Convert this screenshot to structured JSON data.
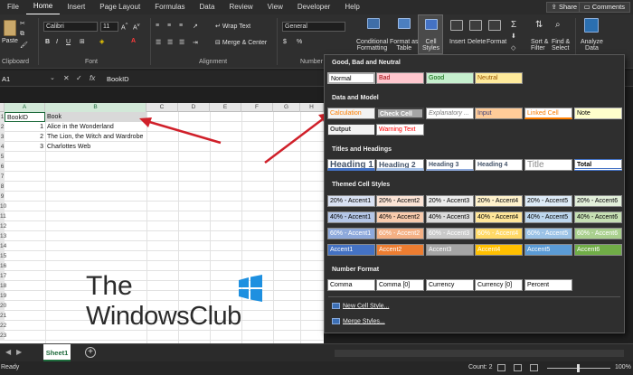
{
  "menu": {
    "tabs": [
      "File",
      "Home",
      "Insert",
      "Page Layout",
      "Formulas",
      "Data",
      "Review",
      "View",
      "Developer",
      "Help"
    ],
    "active": "Home",
    "share": "Share",
    "comments": "Comments"
  },
  "ribbon": {
    "paste": "Paste",
    "font_name": "Calibri",
    "font_size": "11",
    "wrap_text": "Wrap Text",
    "merge_center": "Merge & Center",
    "number_format": "General",
    "conditional_formatting_1": "Conditional",
    "conditional_formatting_2": "Formatting",
    "format_as_table_1": "Format as",
    "format_as_table_2": "Table",
    "cell_styles_1": "Cell",
    "cell_styles_2": "Styles",
    "insert": "Insert",
    "delete": "Delete",
    "format": "Format",
    "sort_filter_1": "Sort &",
    "sort_filter_2": "Filter",
    "find_select_1": "Find &",
    "find_select_2": "Select",
    "analyze_data_1": "Analyze",
    "analyze_data_2": "Data",
    "groups": {
      "clipboard": "Clipboard",
      "font": "Font",
      "alignment": "Alignment",
      "number": "Number"
    },
    "bold": "B",
    "italic": "I",
    "underline": "U",
    "dollar": "$",
    "percent": "%",
    "sigma": "Σ"
  },
  "formula_bar": {
    "name_box": "A1",
    "fx": "fx",
    "content": "BookID"
  },
  "grid": {
    "columns": [
      "A",
      "B",
      "C",
      "D",
      "E",
      "F",
      "G",
      "H"
    ],
    "row_numbers": [
      "1",
      "2",
      "3",
      "4",
      "5",
      "6",
      "7",
      "8",
      "9",
      "10",
      "11",
      "12",
      "13",
      "14",
      "15",
      "16",
      "17",
      "18",
      "19",
      "20",
      "21",
      "22",
      "23"
    ],
    "header_row": [
      "BookID",
      "Book"
    ],
    "rows": [
      {
        "id": "1",
        "book": "Alice in the Wonderland"
      },
      {
        "id": "2",
        "book": "The Lion, the Witch and Wardrobe"
      },
      {
        "id": "3",
        "book": "Charlottes Web"
      }
    ]
  },
  "branding": {
    "line1": "The",
    "line2": "WindowsClub"
  },
  "sheets": {
    "tabs": [
      "Sheet1"
    ],
    "add": "+"
  },
  "status": {
    "ready": "Ready",
    "count": "Count: 2",
    "zoom": "100%"
  },
  "cell_styles": {
    "sections": {
      "good_bad_neutral": "Good, Bad and Neutral",
      "data_model": "Data and Model",
      "titles_headings": "Titles and Headings",
      "themed": "Themed Cell Styles",
      "number_format": "Number Format"
    },
    "good_bad_neutral": [
      "Normal",
      "Bad",
      "Good",
      "Neutral"
    ],
    "data_model": [
      "Calculation",
      "Check Cell",
      "Explanatory ...",
      "Input",
      "Linked Cell",
      "Note",
      "Output",
      "Warning Text"
    ],
    "titles_headings": [
      "Heading 1",
      "Heading 2",
      "Heading 3",
      "Heading 4",
      "Title",
      "Total"
    ],
    "themed_20": [
      "20% - Accent1",
      "20% - Accent2",
      "20% - Accent3",
      "20% - Accent4",
      "20% - Accent5",
      "20% - Accent6"
    ],
    "themed_40": [
      "40% - Accent1",
      "40% - Accent2",
      "40% - Accent3",
      "40% - Accent4",
      "40% - Accent5",
      "40% - Accent6"
    ],
    "themed_60": [
      "60% - Accent1",
      "60% - Accent2",
      "60% - Accent3",
      "60% - Accent4",
      "60% - Accent5",
      "60% - Accent6"
    ],
    "themed_full": [
      "Accent1",
      "Accent2",
      "Accent3",
      "Accent4",
      "Accent5",
      "Accent6"
    ],
    "number_format": [
      "Comma",
      "Comma [0]",
      "Currency",
      "Currency [0]",
      "Percent"
    ],
    "new_style": "New Cell Style...",
    "merge_styles": "Merge Styles..."
  },
  "colors": {
    "excel_green": "#1e6b3c",
    "arrow_red": "#d0202a",
    "accent1": "#4472c4",
    "accent2": "#ed7d31",
    "accent3": "#a5a5a5",
    "accent4": "#ffc000",
    "accent5": "#5b9bd5",
    "accent6": "#70ad47"
  }
}
